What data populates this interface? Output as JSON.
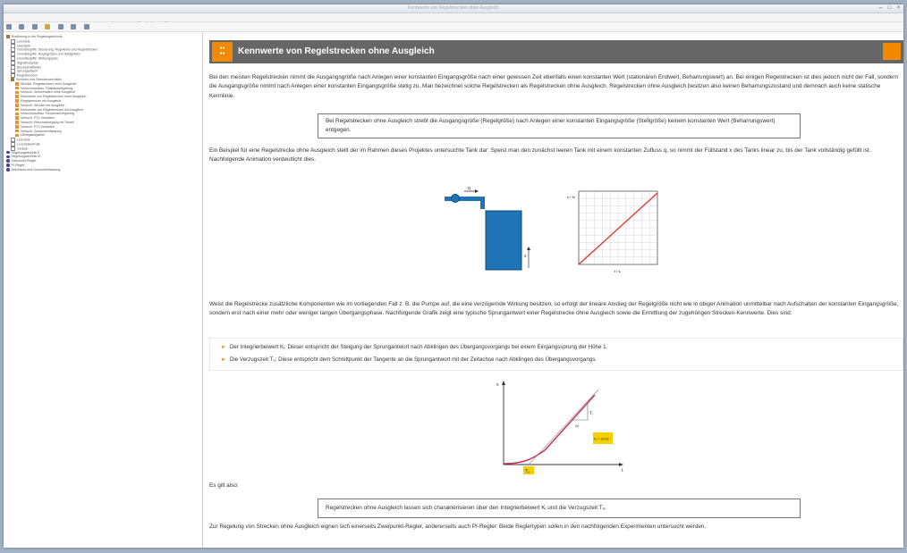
{
  "window": {
    "title": "Kennwerte von Regelstrecken ohne Ausgleich"
  },
  "menu": [
    "Datei",
    "Bearbeiten",
    "Ansicht",
    "Optionen",
    "Werkzeuge",
    "Hilfsmittel",
    "Hilfe"
  ],
  "sidebar": {
    "items": [
      {
        "label": "Einführung in die Regelungstechnik",
        "icon": "book-icon",
        "level": 0
      },
      {
        "label": "Lernziele",
        "icon": "page-icon",
        "level": 1
      },
      {
        "label": "Übersicht",
        "icon": "page-icon",
        "level": 1
      },
      {
        "label": "Grundbegriffe: Steuerung, Regelkreis und Regelstrecken",
        "icon": "page-icon",
        "level": 1
      },
      {
        "label": "Grundbegriffe: Regelgrößen und Stellgrößen",
        "icon": "page-icon",
        "level": 1
      },
      {
        "label": "Grundbegriffe: Wirkungsplan",
        "icon": "page-icon",
        "level": 1
      },
      {
        "label": "Signalflussplan",
        "icon": "page-icon",
        "level": 1
      },
      {
        "label": "Blockschaltbilder",
        "icon": "page-icon",
        "level": 1
      },
      {
        "label": "Sprungantwort",
        "icon": "page-icon",
        "level": 1
      },
      {
        "label": "Regelstrecken",
        "icon": "page-icon",
        "level": 1
      },
      {
        "label": "Strecken und Streckenverhalten",
        "icon": "book-icon",
        "level": 1
      },
      {
        "label": "Strecke: Regelstrecken ohne Ausgleich",
        "icon": "orange-icon",
        "level": 2
      },
      {
        "label": "Versuchsaufbau: Füllstandsregelung",
        "icon": "orange-icon",
        "level": 2
      },
      {
        "label": "Versuch: Zeitverhalten ohne Ausgleich",
        "icon": "orange-icon",
        "level": 2
      },
      {
        "label": "Kennwerte von Regelstrecken ohne Ausgleich",
        "icon": "orange-icon",
        "level": 2
      },
      {
        "label": "Regelstrecken mit Ausgleich",
        "icon": "orange-icon",
        "level": 2
      },
      {
        "label": "Versuch: Strecke mit Ausgleich",
        "icon": "orange-icon",
        "level": 2
      },
      {
        "label": "Kennwerte von Regelstrecken mit Ausgleich",
        "icon": "orange-icon",
        "level": 2
      },
      {
        "label": "Versuchsaufbau: Temperaturregelung",
        "icon": "orange-icon",
        "level": 2
      },
      {
        "label": "Versuch: PT1-Verhalten",
        "icon": "orange-icon",
        "level": 2
      },
      {
        "label": "Versuch: Einschaltvorgang mit Totzeit",
        "icon": "orange-icon",
        "level": 2
      },
      {
        "label": "Versuch: PT2-Verhalten",
        "icon": "orange-icon",
        "level": 2
      },
      {
        "label": "Versuch: Zusammenfassung",
        "icon": "orange-icon",
        "level": 2
      },
      {
        "label": "Übungsaufgaben",
        "icon": "orange-icon",
        "level": 2
      },
      {
        "label": "Lernziele",
        "icon": "page-icon",
        "level": 1
      },
      {
        "label": "Lernzielkontrolle",
        "icon": "page-icon",
        "level": 1
      },
      {
        "label": "Glossar",
        "icon": "page-icon",
        "level": 1
      },
      {
        "label": "Regelungstechnik II",
        "icon": "bullet-icon",
        "level": 0
      },
      {
        "label": "Regelungstechnik III",
        "icon": "bullet-icon",
        "level": 0
      },
      {
        "label": "Zweipunkt-Regler",
        "icon": "bullet-icon",
        "level": 0
      },
      {
        "label": "PI-Regler",
        "icon": "bullet-icon",
        "level": 0
      },
      {
        "label": "Abschluss und Zusammenfassung",
        "icon": "bullet-icon",
        "level": 0
      }
    ]
  },
  "page": {
    "title": "Kennwerte von Regelstrecken ohne Ausgleich",
    "p1": "Bei den meisten Regelstrecken nimmt die Ausgangsgröße nach Anlegen einer konstanten Eingangsgröße nach einer gewissen Zeit ebenfalls einen konstanten Wert (stationären Endwert, Beharrungswert) an. Bei einigen Regelstrecken ist dies jedoch nicht der Fall, sondern die Ausgangsgröße nimmt nach Anlegen einer konstanten Eingangsgröße stetig zu. Man bezeichnet solche Regelstrecken als Regelstrecken ohne Ausgleich. Regelstrecken ohne Ausgleich besitzen also keinen Beharrungszustand und demnach auch keine statische Kennlinie.",
    "box1": "Bei Regelstrecken ohne Ausgleich strebt die Ausgangsgröße (Regelgröße) nach Anlegen einer konstanten Eingangsgröße (Stellgröße) keinem konstanten Wert (Beharrungswert) entgegen.",
    "p2": "Ein Beispiel für eine Regelstrecke ohne Ausgleich stellt der im Rahmen dieses Projektes untersuchte Tank dar: Speist man den zunächst leeren Tank mit einem konstanten Zufluss q, so nimmt der Füllstand x des Tanks linear zu, bis der Tank vollständig gefüllt ist. Nachfolgende Animation verdeutlicht dies.",
    "p3": "Weist die Regelstrecke zusätzliche Komponenten wie im vorliegenden Fall z. B. die Pumpe auf, die eine verzögernde Wirkung besitzen, so erfolgt der lineare Anstieg der Regelgröße nicht wie in obiger Animation unmittelbar nach Aufschalten der konstanten Eingangsgröße, sondern erst nach einer mehr oder weniger langen Übergangsphase. Nachfolgende Grafik zeigt eine typische Sprungantwort einer Regelstrecke ohne Ausgleich sowie die Ermittlung der zugehörigen Strecken-Kennwerte. Dies sind:",
    "bullet1": "Der Integrierbeiwert Kᵢ: Dieser entspricht der Steigung der Sprungantwort nach Abklingen des Übergangsvorgangs bei einem Eingangssprung der Höhe 1.",
    "bullet2": "Die Verzugszeit Tᵤ: Diese entspricht dem Schnittpunkt der Tangente an die Sprungantwort mit der Zeitachse nach Abklingen des Übergangsvorgangs.",
    "es_gilt": "Es gilt also:",
    "box2": "Regelstrecken ohne Ausgleich lassen sich charakterisieren über den Integrierbeiwert Kᵢ und die Verzugszeit Tᵤ.",
    "p4": "Zur Regelung von Strecken ohne Ausgleich eignen sich einerseits Zweipunkt-Regler, andererseits auch PI-Regler. Beide Reglertypen sollen in den nachfolgenden Experimenten untersucht werden."
  },
  "figure1": {
    "q_label": "q",
    "x_label": "x",
    "xaxis": "t / s",
    "yaxis": "x / %"
  },
  "figure2": {
    "y_label": "x",
    "t_label": "t",
    "ti_label": "Tᵢ",
    "tu_label": "Tᵤ",
    "ki_formula": "Kᵢ = Δx/Δt",
    "line_color": "#cc3366",
    "highlight_color": "#f5d000"
  },
  "colors": {
    "accent": "#f18a00",
    "header_bg": "#666666",
    "tank": "#1f74b8"
  }
}
